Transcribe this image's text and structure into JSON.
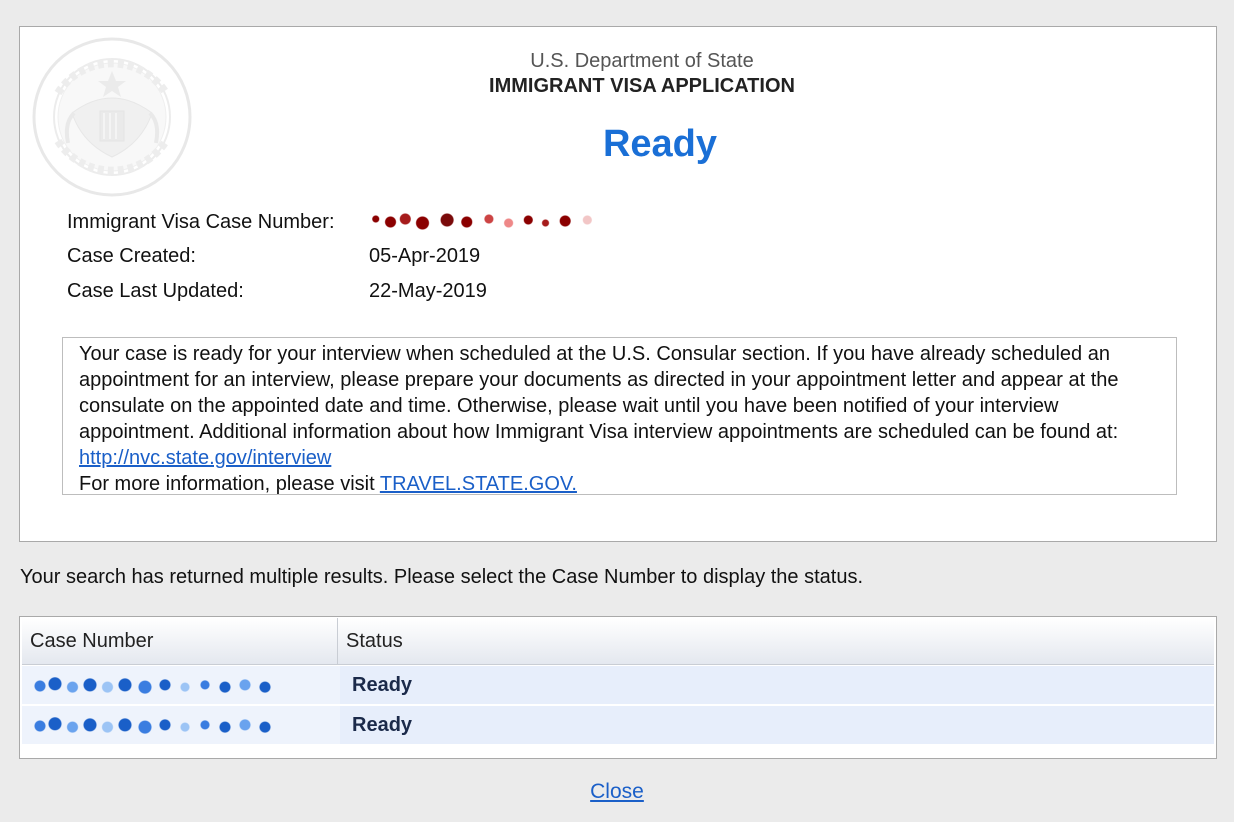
{
  "header": {
    "department": "U.S. Department of State",
    "application_title": "IMMIGRANT VISA APPLICATION",
    "status": "Ready",
    "status_color": "#1a6fd6"
  },
  "case_info": {
    "case_number_label": "Immigrant Visa Case Number:",
    "case_created_label": "Case Created:",
    "case_created_value": "05-Apr-2019",
    "case_updated_label": "Case Last Updated:",
    "case_updated_value": "22-May-2019"
  },
  "message": {
    "text": "Your case is ready for your interview when scheduled at the U.S. Consular section. If you have already scheduled an appointment for an interview, please prepare your documents as directed in your appointment letter and appear at the consulate on the appointed date and time. Otherwise, please wait until you have been notified of your interview appointment. Additional information about how Immigrant Visa interview appointments are scheduled can be found at: ",
    "interview_link": "http://nvc.state.gov/interview",
    "more_info_text": "For more information, please visit ",
    "travel_link": "TRAVEL.STATE.GOV."
  },
  "search_message": "Your search has returned multiple results. Please select the Case Number to display the status.",
  "results": {
    "columns": [
      "Case Number",
      "Status"
    ],
    "rows": [
      {
        "status": "Ready"
      },
      {
        "status": "Ready"
      }
    ]
  },
  "close_label": "Close",
  "icons": {
    "seal": "department-of-state-seal-icon"
  },
  "colors": {
    "link": "#1a5fc8",
    "background": "#ebebeb"
  }
}
